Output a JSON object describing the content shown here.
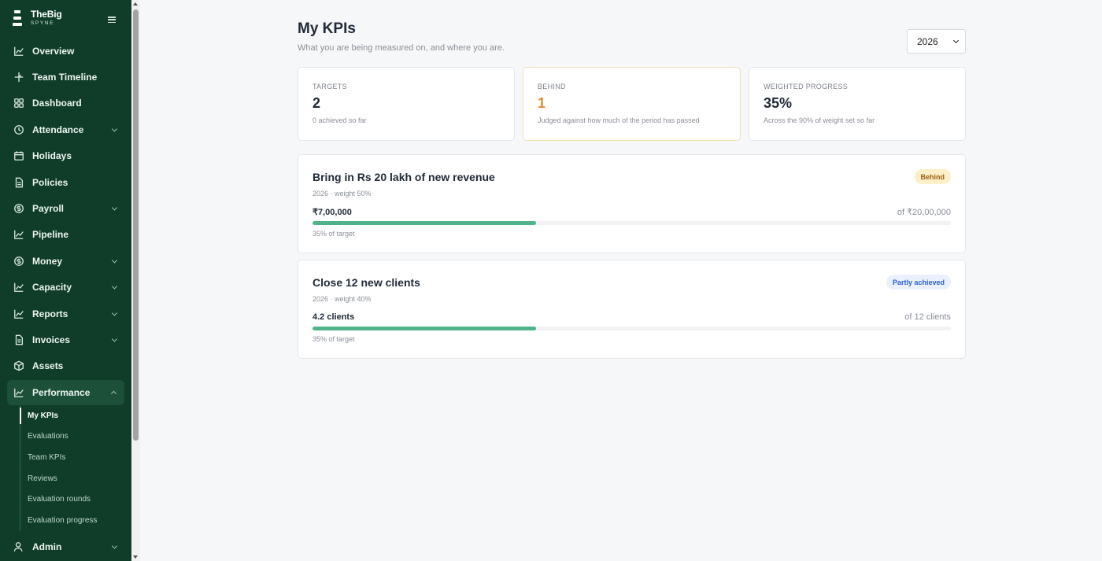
{
  "brand": {
    "name": "TheBig",
    "sub": "SPYNE"
  },
  "nav": [
    {
      "label": "Overview",
      "icon": "chart-line-icon",
      "chevron": false
    },
    {
      "label": "Team Timeline",
      "icon": "timeline-icon",
      "chevron": false
    },
    {
      "label": "Dashboard",
      "icon": "grid-icon",
      "chevron": false
    },
    {
      "label": "Attendance",
      "icon": "clock-icon",
      "chevron": true
    },
    {
      "label": "Holidays",
      "icon": "calendar-icon",
      "chevron": false
    },
    {
      "label": "Policies",
      "icon": "document-icon",
      "chevron": false
    },
    {
      "label": "Payroll",
      "icon": "currency-icon",
      "chevron": true
    },
    {
      "label": "Pipeline",
      "icon": "chart-line-icon",
      "chevron": false
    },
    {
      "label": "Money",
      "icon": "currency-icon",
      "chevron": true
    },
    {
      "label": "Capacity",
      "icon": "chart-line-icon",
      "chevron": true
    },
    {
      "label": "Reports",
      "icon": "chart-line-icon",
      "chevron": true
    },
    {
      "label": "Invoices",
      "icon": "document-icon",
      "chevron": true
    },
    {
      "label": "Assets",
      "icon": "box-icon",
      "chevron": false
    }
  ],
  "performance": {
    "label": "Performance",
    "sub_items": [
      "My KPIs",
      "Evaluations",
      "Team KPIs",
      "Reviews",
      "Evaluation rounds",
      "Evaluation progress"
    ],
    "active_sub": "My KPIs"
  },
  "admin": {
    "label": "Admin"
  },
  "page": {
    "title": "My KPIs",
    "subtitle": "What you are being measured on, and where you are.",
    "year": "2026"
  },
  "stats": {
    "targets": {
      "label": "TARGETS",
      "value": "2",
      "note": "0 achieved so far"
    },
    "behind": {
      "label": "BEHIND",
      "value": "1",
      "note": "Judged against how much of the period has passed"
    },
    "weighted": {
      "label": "WEIGHTED PROGRESS",
      "value": "35%",
      "note": "Across the 90% of weight set so far"
    }
  },
  "kpis": [
    {
      "title": "Bring in Rs 20 lakh of new revenue",
      "meta": "2026 · weight 50%",
      "current": "₹7,00,000",
      "target": "of ₹20,00,000",
      "progress": 0.35,
      "pct_label": "35% of target",
      "status": "Behind",
      "status_color": "#fdf0c8"
    },
    {
      "title": "Close 12 new clients",
      "meta": "2026 · weight 40%",
      "current": "4.2 clients",
      "target": "of 12 clients",
      "progress": 0.35,
      "pct_label": "35% of target",
      "status": "Partly achieved",
      "status_color": "#eaf1fd"
    }
  ],
  "colors": {
    "sidebar": "#0f3d2a",
    "progress": "#52b38b",
    "behind_value": "#e8892c"
  }
}
